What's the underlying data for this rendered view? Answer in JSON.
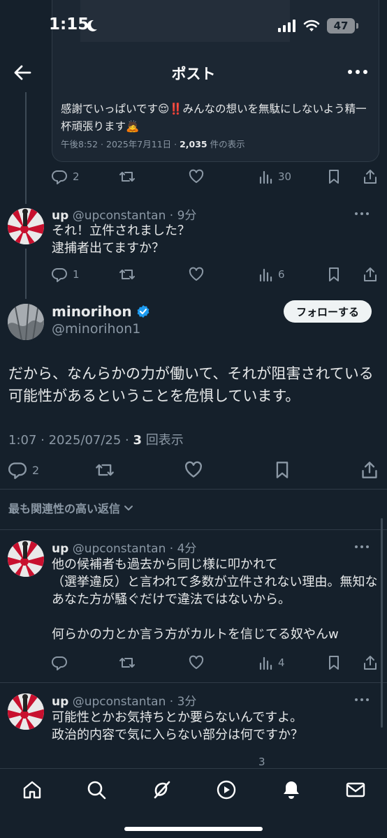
{
  "status_bar": {
    "time": "1:15",
    "battery": "47"
  },
  "nav": {
    "title": "ポスト"
  },
  "quoted_tweet": {
    "text": "感謝でいっぱいです😌‼️みんなの想いを無駄にしないよう精一杯頑張ります🙇",
    "meta_prefix": "午後8:52 · 2025年7月11日 · ",
    "views": "2,035",
    "views_suffix": " 件の表示",
    "actions": {
      "replies": "2",
      "views": "30"
    }
  },
  "reply1": {
    "name": "up",
    "handle": "@upconstantan",
    "time": "· 9分",
    "text": "それ！立件されました？\n逮捕者出てますか？",
    "actions": {
      "replies": "1",
      "views": "6"
    }
  },
  "main_post": {
    "name": "minorihon",
    "handle": "@minorihon1",
    "follow_label": "フォローする",
    "text": "だから、なんらかの力が働いて、それが阻害されている可能性があるということを危惧しています。",
    "meta_prefix": "1:07 · 2025/07/25 · ",
    "views": "3",
    "views_suffix": " 回表示",
    "actions": {
      "replies": "2"
    }
  },
  "relevance_label": "最も関連性の高い返信",
  "reply2": {
    "name": "up",
    "handle": "@upconstantan",
    "time": "· 4分",
    "text": "他の候補者も過去から同じ様に叩かれて\n（選挙違反）と言われて多数が立件されない理由。無知なあなた方が騒ぐだけで違法ではないから。\n\n何らかの力とか言う方がカルトを信じてる奴やんw",
    "actions": {
      "views": "4"
    }
  },
  "reply3": {
    "name": "up",
    "handle": "@upconstantan",
    "time": "· 3分",
    "text": "可能性とかお気持ちとか要らないんですよ。\n政治的内容で気に入らない部分は何ですか？",
    "actions": {
      "views": "3"
    }
  },
  "colors": {
    "background": "#15202b",
    "text": "#e7e9ea",
    "muted": "#8b98a5",
    "verified": "#1d9bf0"
  }
}
